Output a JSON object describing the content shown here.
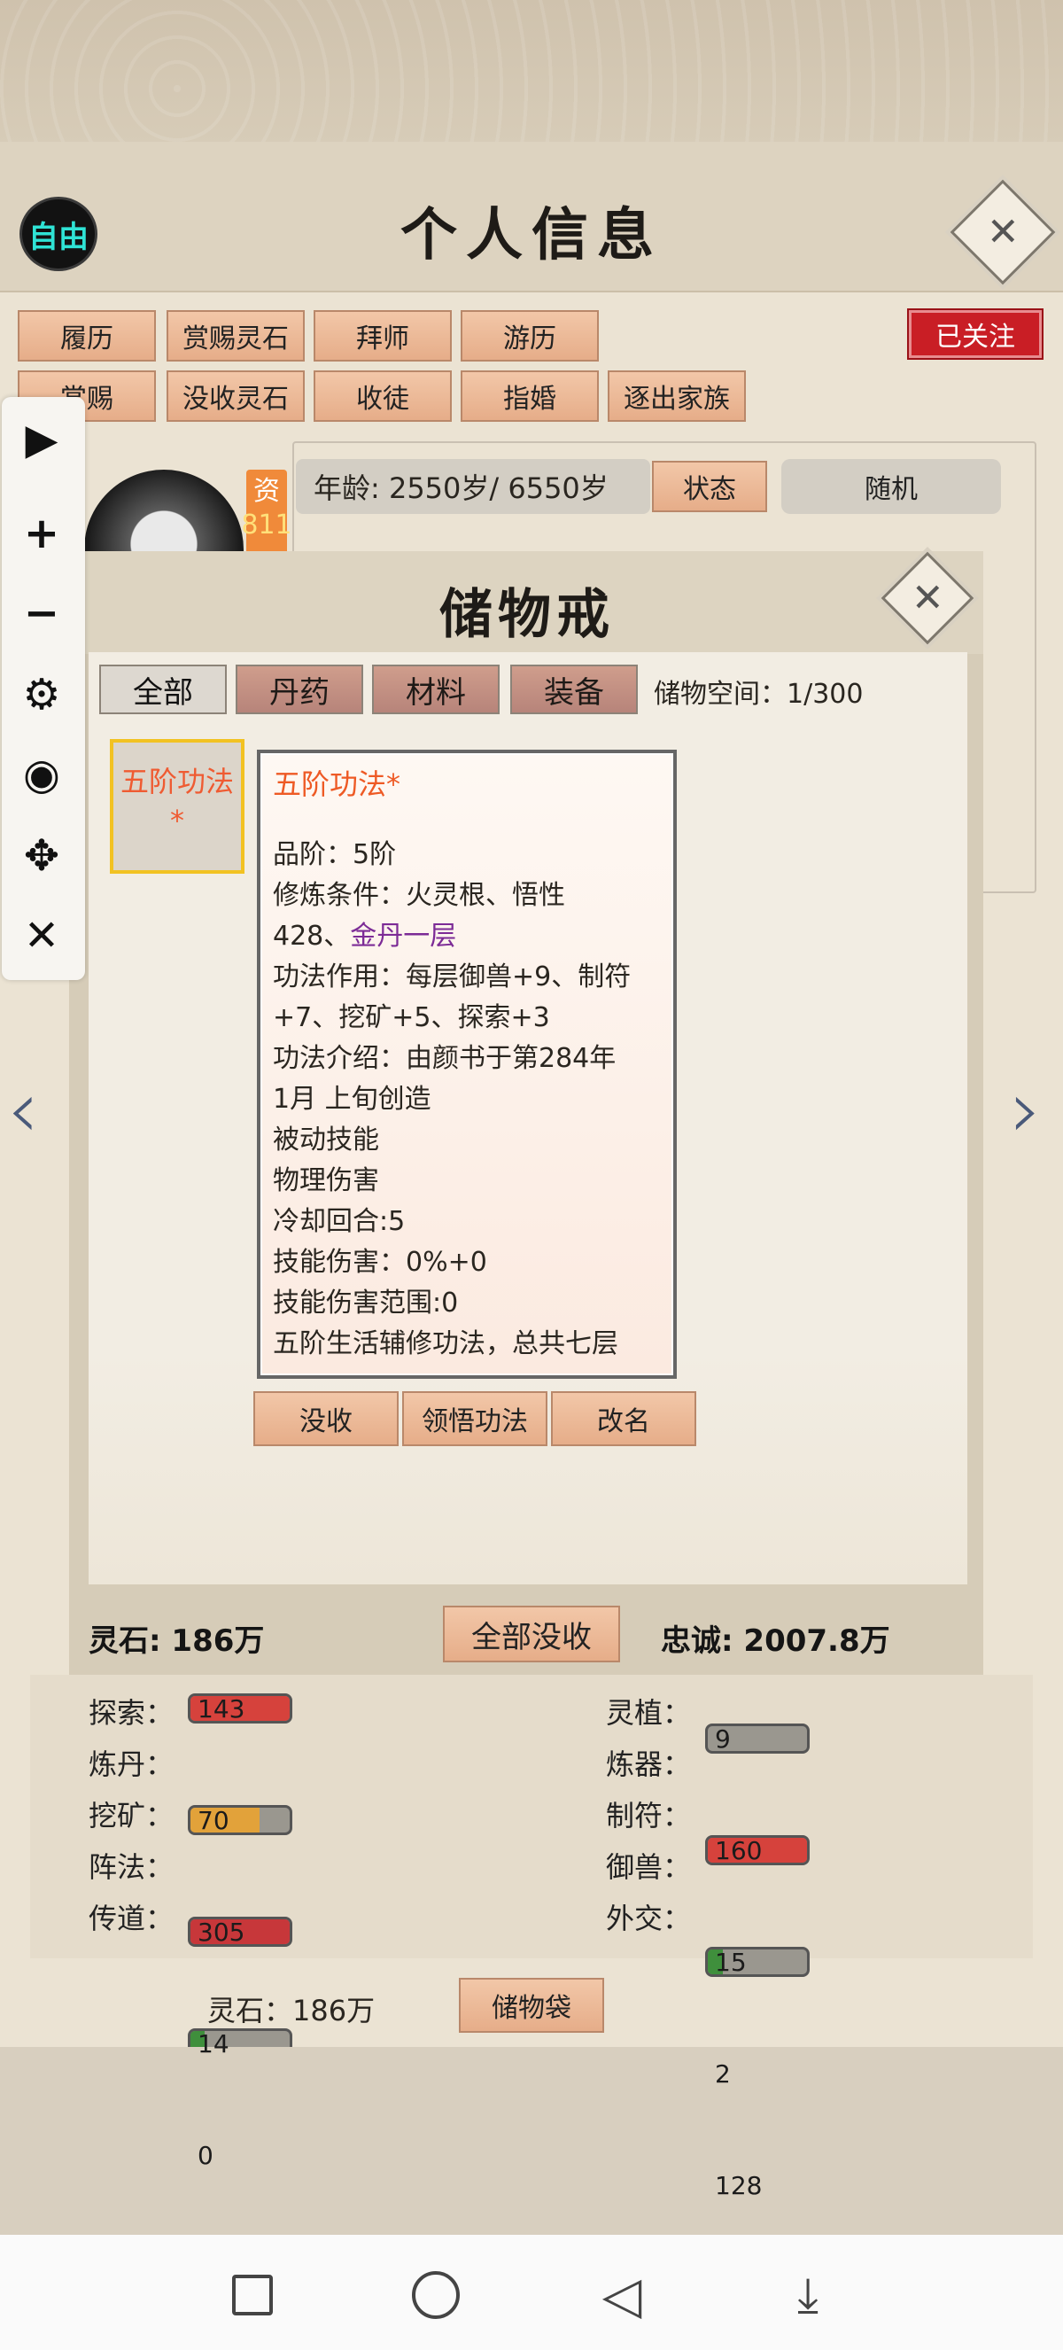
{
  "header": {
    "title": "个人信息",
    "mode_badge": "自由",
    "close_label": "✕",
    "follow_label": "已关注"
  },
  "actions_row1": [
    "履历",
    "赏赐灵石",
    "拜师",
    "游历"
  ],
  "actions_row2": [
    "赏赐",
    "没收灵石",
    "收徒",
    "指婚",
    "逐出家族"
  ],
  "profile": {
    "aptitude_label": "资",
    "aptitude_value": "811",
    "age_text": "年龄: 2550岁/ 6550岁",
    "status_label": "状态",
    "random_label": "随机"
  },
  "sidebar": {
    "icons": [
      "play-icon",
      "plus-icon",
      "minus-icon",
      "gear-icon",
      "eye-icon",
      "move-icon",
      "close-icon"
    ]
  },
  "ring": {
    "title": "储物戒",
    "tabs": [
      "全部",
      "丹药",
      "材料",
      "装备"
    ],
    "space_text": "储物空间：1/300",
    "slot_item": [
      "五阶功法",
      "*"
    ],
    "detail": {
      "title": "五阶功法*",
      "lines": [
        "品阶：5阶",
        "修炼条件：火灵根、悟性"
      ],
      "cond_prefix": "428、",
      "cond_highlight": "金丹一层",
      "more_lines": [
        "功法作用：每层御兽+9、制符",
        "+7、挖矿+5、探索+3",
        "功法介绍：由颜书于第284年",
        "1月 上旬创造",
        "被动技能",
        "物理伤害",
        "冷却回合:5",
        "技能伤害：0%+0",
        "技能伤害范围:0",
        "五阶生活辅修功法，总共七层"
      ]
    },
    "buttons": [
      "没收",
      "领悟功法",
      "改名"
    ],
    "stones": "灵石: 186万",
    "confiscate_all": "全部没收",
    "loyalty": "忠诚: 2007.8万"
  },
  "stats": [
    {
      "label": "探索：",
      "value": "143",
      "pct": 1.0,
      "color": "#d6423c"
    },
    {
      "label": "灵植：",
      "value": "9",
      "pct": 0.0,
      "color": "#8c8a86"
    },
    {
      "label": "炼丹：",
      "value": "70",
      "pct": 0.7,
      "color": "#e2a23a"
    },
    {
      "label": "炼器：",
      "value": "160",
      "pct": 1.0,
      "color": "#d6423c"
    },
    {
      "label": "挖矿：",
      "value": "305",
      "pct": 1.0,
      "color": "#c7373a"
    },
    {
      "label": "制符：",
      "value": "15",
      "pct": 0.15,
      "color": "#3f8f3c"
    },
    {
      "label": "阵法：",
      "value": "14",
      "pct": 0.14,
      "color": "#3f8f3c"
    },
    {
      "label": "御兽：",
      "value": "2",
      "pct": 0.0,
      "color": "#8c8a86"
    },
    {
      "label": "传道：",
      "value": "0",
      "pct": 0.0,
      "color": "#8c8a86"
    },
    {
      "label": "外交：",
      "value": "128",
      "pct": 1.0,
      "color": "#d6423c"
    }
  ],
  "footer": {
    "stones": "灵石：186万",
    "bag_label": "储物袋"
  },
  "colors": {
    "accent": "#e6ad89",
    "follow": "#c91e25",
    "slot_border": "#f2c222"
  }
}
